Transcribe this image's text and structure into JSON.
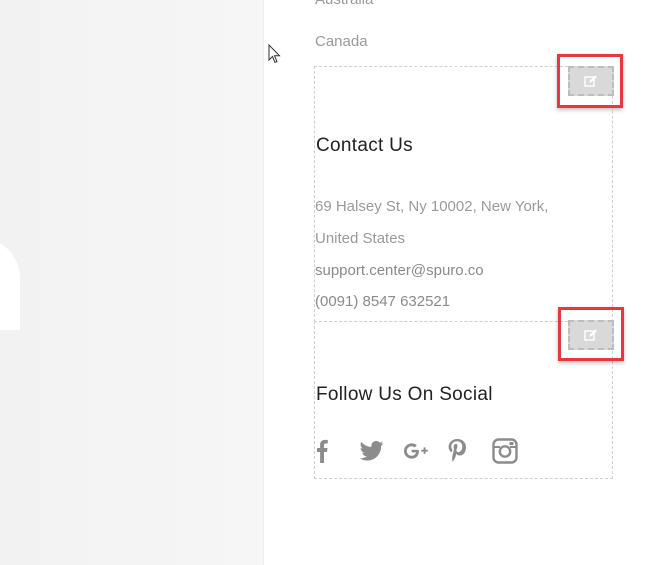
{
  "countries": {
    "previous": "Australia",
    "current": "Canada"
  },
  "contact": {
    "heading": "Contact Us",
    "address_line1": "69 Halsey St, Ny 10002, New York,",
    "address_line2": "United States",
    "email": "support.center@spuro.co",
    "phone": "(0091) 8547 632521"
  },
  "social": {
    "heading": "Follow Us On Social",
    "icons": [
      "facebook-icon",
      "twitter-icon",
      "google-plus-icon",
      "pinterest-icon",
      "instagram-icon"
    ]
  },
  "colors": {
    "highlight": "#e5393c",
    "icon": "#8c8c8c",
    "edit_button": "#d9d9d9"
  }
}
